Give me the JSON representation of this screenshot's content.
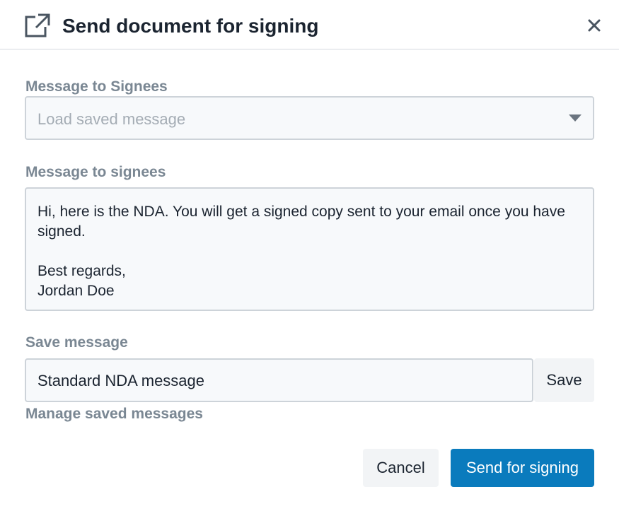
{
  "dialog": {
    "title": "Send document for signing",
    "icon": "external-link-icon",
    "close_icon": "close-icon"
  },
  "saved_message": {
    "label": "Message to Signees",
    "placeholder": "Load saved message",
    "caret_icon": "caret-down-icon"
  },
  "message": {
    "label": "Message to signees",
    "value": "Hi, here is the NDA. You will get a signed copy sent to your email once you have signed.\n\nBest regards,\nJordan Doe"
  },
  "save_message": {
    "label": "Save message",
    "value": "Standard NDA message",
    "button_label": "Save",
    "manage_link": "Manage saved messages"
  },
  "actions": {
    "cancel_label": "Cancel",
    "send_label": "Send for signing"
  },
  "colors": {
    "primary": "#0a7bbd",
    "label": "#7a8793",
    "field_bg": "#f7f9fb",
    "field_border": "#cdd3d9"
  }
}
